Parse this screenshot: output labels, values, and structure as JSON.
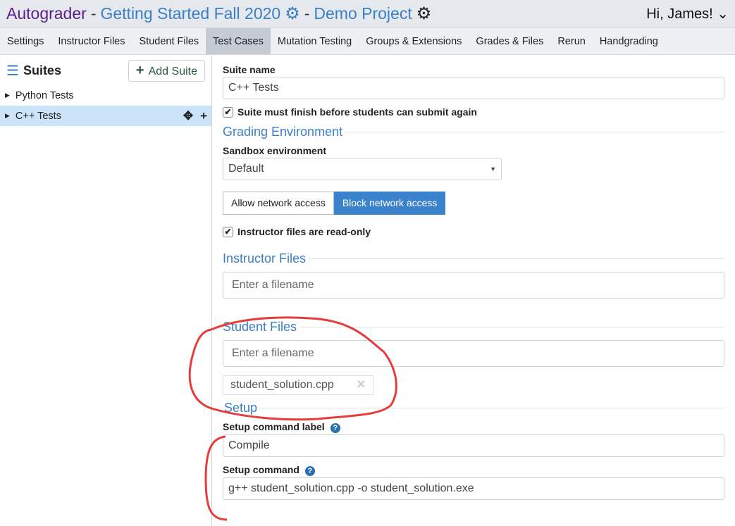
{
  "header": {
    "app": "Autograder",
    "course": "Getting Started Fall 2020",
    "project": "Demo Project",
    "greeting": "Hi, James!"
  },
  "nav": {
    "tabs": [
      "Settings",
      "Instructor Files",
      "Student Files",
      "Test Cases",
      "Mutation Testing",
      "Groups & Extensions",
      "Grades & Files",
      "Rerun",
      "Handgrading"
    ],
    "active": "Test Cases"
  },
  "sidebar": {
    "title": "Suites",
    "add_label": "Add Suite",
    "items": [
      {
        "label": "Python Tests"
      },
      {
        "label": "C++ Tests",
        "selected": true
      }
    ]
  },
  "main": {
    "suite_name_label": "Suite name",
    "suite_name": "C++ Tests",
    "must_finish_label": "Suite must finish before students can submit again",
    "grading_env": "Grading Environment",
    "sandbox_label": "Sandbox environment",
    "sandbox_value": "Default",
    "allow_net": "Allow network access",
    "block_net": "Block network access",
    "readonly_label": "Instructor files are read-only",
    "instructor_files": "Instructor Files",
    "instructor_placeholder": "Enter a filename",
    "student_files": "Student Files",
    "student_placeholder": "Enter a filename",
    "student_file_chip": "student_solution.cpp",
    "setup": "Setup",
    "setup_label_label": "Setup command label",
    "setup_label_value": "Compile",
    "setup_cmd_label": "Setup command",
    "setup_cmd_value": "g++ student_solution.cpp -o student_solution.exe"
  },
  "colors": {
    "brand": "#5b1f86",
    "link": "#3b7fc4",
    "selected_row": "#cce4fa",
    "active_button": "#3b82cc",
    "annotation": "#e53c3c"
  }
}
